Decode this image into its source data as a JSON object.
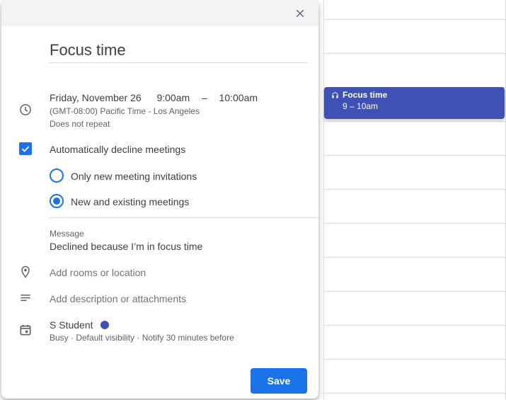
{
  "event": {
    "title": "Focus time",
    "date": "Friday, November 26",
    "start_time": "9:00am",
    "dash": "–",
    "end_time": "10:00am",
    "timezone": "(GMT-08:00) Pacific Time - Los Angeles",
    "repeat": "Does not repeat"
  },
  "decline": {
    "label": "Automatically decline meetings",
    "checked": true,
    "options": [
      {
        "label": "Only new meeting invitations",
        "selected": false
      },
      {
        "label": "New and existing meetings",
        "selected": true
      }
    ]
  },
  "message": {
    "label": "Message",
    "value": "Declined because I’m in focus time"
  },
  "location": {
    "placeholder": "Add rooms or location"
  },
  "description": {
    "placeholder": "Add description or attachments"
  },
  "owner": {
    "name": "S Student",
    "color": "#3f51b5",
    "meta": "Busy · Default visibility · Notify 30 minutes before"
  },
  "actions": {
    "save_label": "Save"
  },
  "calendar_event": {
    "title": "Focus time",
    "time": "9 – 10am",
    "color": "#3f51b5"
  },
  "icons": {
    "close": "close-icon",
    "clock": "clock-icon",
    "location": "location-pin-icon",
    "description": "notes-icon",
    "calendar": "calendar-icon",
    "headphones": "headphones-icon",
    "check": "check-icon"
  },
  "colors": {
    "accent": "#1a73e8",
    "event": "#3f51b5"
  }
}
